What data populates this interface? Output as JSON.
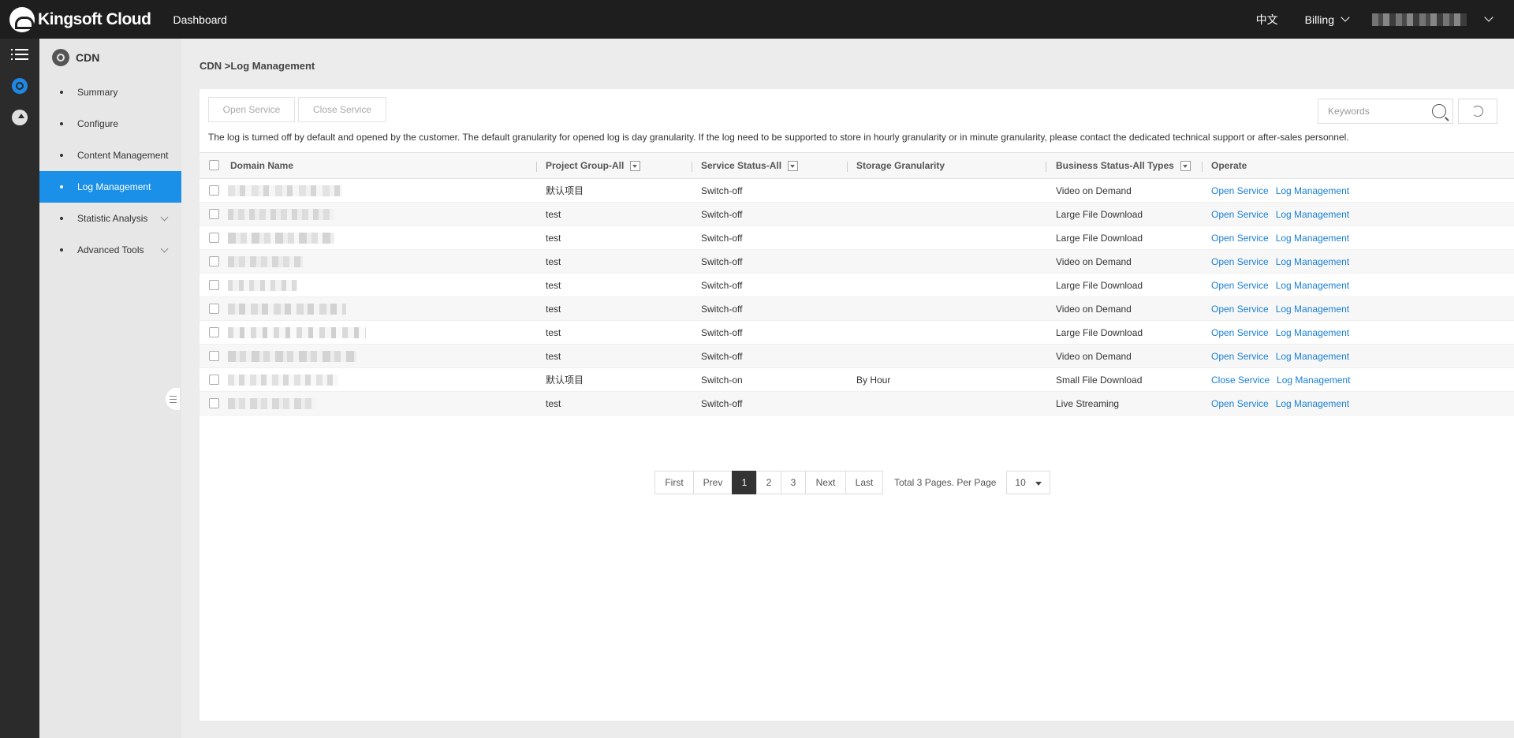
{
  "topbar": {
    "brand": "Kingsoft Cloud",
    "dashboard": "Dashboard",
    "language": "中文",
    "billing": "Billing"
  },
  "sidebar": {
    "title": "CDN",
    "items": [
      {
        "label": "Summary"
      },
      {
        "label": "Configure"
      },
      {
        "label": "Content Management"
      },
      {
        "label": "Log Management"
      },
      {
        "label": "Statistic Analysis"
      },
      {
        "label": "Advanced Tools"
      }
    ]
  },
  "main": {
    "breadcrumb": "CDN >Log Management",
    "open_service_label": "Open Service",
    "close_service_label": "Close Service",
    "search_placeholder": "Keywords",
    "notice": "The log is turned off by default and opened by the customer. The default granularity for opened log is day granularity. If the log need to be supported to store in hourly granularity or in minute granularity, please contact the dedicated technical support or after-sales personnel."
  },
  "table": {
    "columns": {
      "domain": "Domain Name",
      "project": "Project Group-All",
      "service": "Service Status-All",
      "storage": "Storage Granularity",
      "business": "Business Status-All Types",
      "operate": "Operate"
    },
    "rows": [
      {
        "project": "默认项目",
        "service": "Switch-off",
        "storage": "",
        "business": "Video on Demand",
        "action": "Open Service",
        "log": "Log Management"
      },
      {
        "project": "test",
        "service": "Switch-off",
        "storage": "",
        "business": "Large File Download",
        "action": "Open Service",
        "log": "Log Management"
      },
      {
        "project": "test",
        "service": "Switch-off",
        "storage": "",
        "business": "Large File Download",
        "action": "Open Service",
        "log": "Log Management"
      },
      {
        "project": "test",
        "service": "Switch-off",
        "storage": "",
        "business": "Video on Demand",
        "action": "Open Service",
        "log": "Log Management"
      },
      {
        "project": "test",
        "service": "Switch-off",
        "storage": "",
        "business": "Large File Download",
        "action": "Open Service",
        "log": "Log Management"
      },
      {
        "project": "test",
        "service": "Switch-off",
        "storage": "",
        "business": "Video on Demand",
        "action": "Open Service",
        "log": "Log Management"
      },
      {
        "project": "test",
        "service": "Switch-off",
        "storage": "",
        "business": "Large File Download",
        "action": "Open Service",
        "log": "Log Management"
      },
      {
        "project": "test",
        "service": "Switch-off",
        "storage": "",
        "business": "Video on Demand",
        "action": "Open Service",
        "log": "Log Management"
      },
      {
        "project": "默认项目",
        "service": "Switch-on",
        "storage": "By Hour",
        "business": "Small File Download",
        "action": "Close Service",
        "log": "Log Management"
      },
      {
        "project": "test",
        "service": "Switch-off",
        "storage": "",
        "business": "Live Streaming",
        "action": "Open Service",
        "log": "Log Management"
      }
    ]
  },
  "pagination": {
    "first": "First",
    "prev": "Prev",
    "pages": [
      "1",
      "2",
      "3"
    ],
    "current": "1",
    "next": "Next",
    "last": "Last",
    "summary": "Total 3 Pages. Per Page",
    "per_page": "10"
  },
  "colors": {
    "accent": "#1a90e8",
    "link": "#1a7fd4",
    "topbar": "#1e1e1e"
  }
}
